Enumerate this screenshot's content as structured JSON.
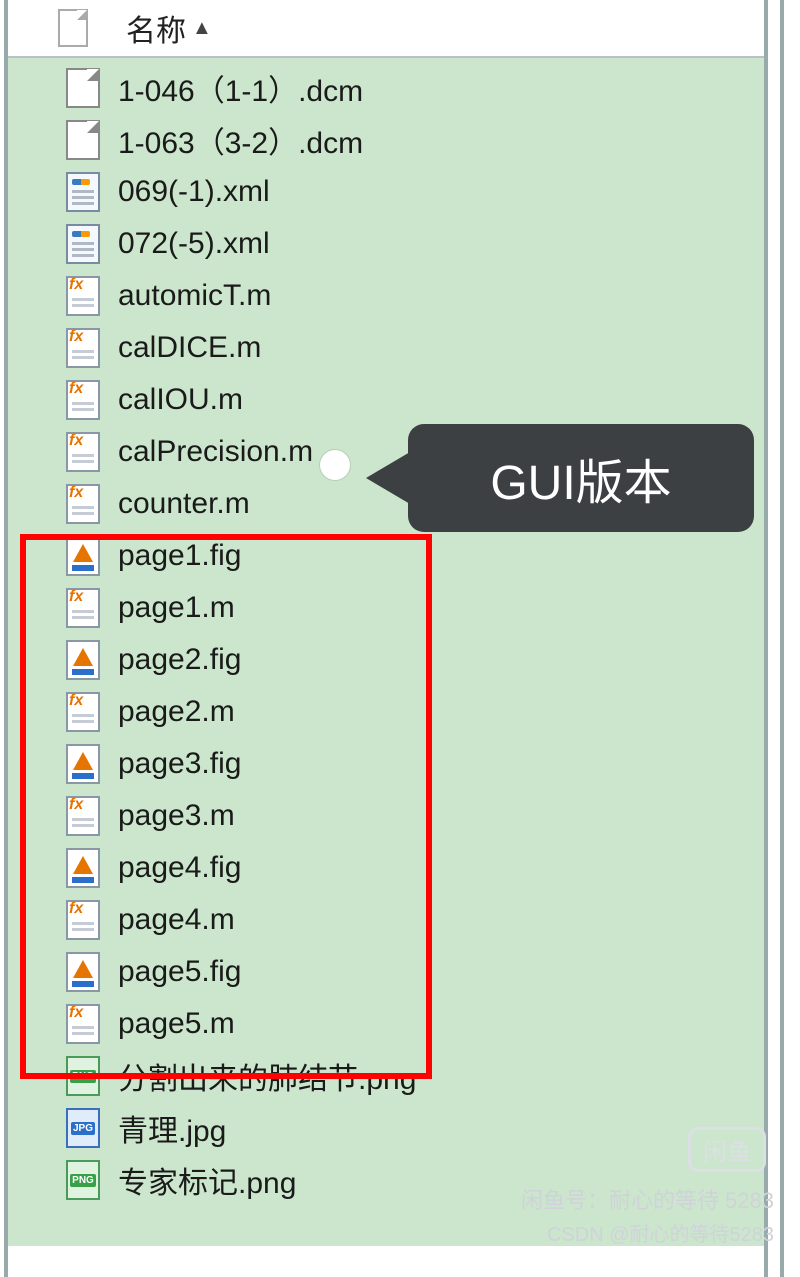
{
  "header": {
    "column_label": "名称",
    "sort_indicator": "▲"
  },
  "callout": {
    "label": "GUI版本"
  },
  "files": [
    {
      "name": "1-046（1-1）.dcm",
      "icon": "ico-file",
      "icon_name": "generic-file-icon"
    },
    {
      "name": "1-063（3-2）.dcm",
      "icon": "ico-file",
      "icon_name": "generic-file-icon"
    },
    {
      "name": "069(-1).xml",
      "icon": "ico-xml",
      "icon_name": "xml-file-icon"
    },
    {
      "name": "072(-5).xml",
      "icon": "ico-xml",
      "icon_name": "xml-file-icon"
    },
    {
      "name": "automicT.m",
      "icon": "ico-m",
      "icon_name": "m-file-icon"
    },
    {
      "name": "calDICE.m",
      "icon": "ico-m",
      "icon_name": "m-file-icon"
    },
    {
      "name": "calIOU.m",
      "icon": "ico-m",
      "icon_name": "m-file-icon"
    },
    {
      "name": "calPrecision.m",
      "icon": "ico-m",
      "icon_name": "m-file-icon"
    },
    {
      "name": "counter.m",
      "icon": "ico-m",
      "icon_name": "m-file-icon"
    },
    {
      "name": "page1.fig",
      "icon": "ico-fig",
      "icon_name": "fig-file-icon"
    },
    {
      "name": "page1.m",
      "icon": "ico-m",
      "icon_name": "m-file-icon"
    },
    {
      "name": "page2.fig",
      "icon": "ico-fig",
      "icon_name": "fig-file-icon"
    },
    {
      "name": "page2.m",
      "icon": "ico-m",
      "icon_name": "m-file-icon"
    },
    {
      "name": "page3.fig",
      "icon": "ico-fig",
      "icon_name": "fig-file-icon"
    },
    {
      "name": "page3.m",
      "icon": "ico-m",
      "icon_name": "m-file-icon"
    },
    {
      "name": "page4.fig",
      "icon": "ico-fig",
      "icon_name": "fig-file-icon"
    },
    {
      "name": "page4.m",
      "icon": "ico-m",
      "icon_name": "m-file-icon"
    },
    {
      "name": "page5.fig",
      "icon": "ico-fig",
      "icon_name": "fig-file-icon"
    },
    {
      "name": "page5.m",
      "icon": "ico-m",
      "icon_name": "m-file-icon"
    },
    {
      "name": "分割出来的肺结节.png",
      "icon": "ico-png",
      "icon_name": "png-file-icon"
    },
    {
      "name": "青理.jpg",
      "icon": "ico-jpg",
      "icon_name": "jpg-file-icon"
    },
    {
      "name": "专家标记.png",
      "icon": "ico-png",
      "icon_name": "png-file-icon"
    }
  ],
  "watermark": {
    "badge": "闲鱼",
    "line1": "闲鱼号：耐心的等待 5283",
    "line2": "CSDN @耐心的等待5283"
  }
}
